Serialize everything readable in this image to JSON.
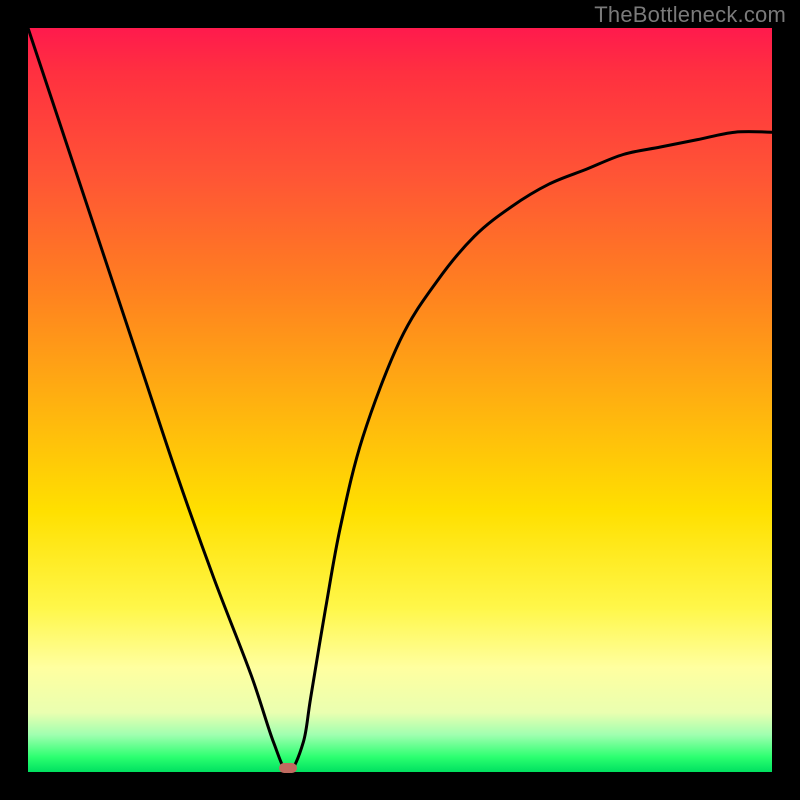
{
  "watermark": "TheBottleneck.com",
  "colors": {
    "frame": "#000000",
    "curve": "#000000",
    "min_marker": "#c06a60",
    "gradient_top": "#ff1a4d",
    "gradient_bottom": "#00e060"
  },
  "chart_data": {
    "type": "line",
    "title": "",
    "xlabel": "",
    "ylabel": "",
    "xlim": [
      0,
      100
    ],
    "ylim": [
      0,
      100
    ],
    "series": [
      {
        "name": "bottleneck-curve",
        "x": [
          0,
          5,
          10,
          15,
          20,
          25,
          30,
          33,
          35,
          37,
          38,
          40,
          42,
          45,
          50,
          55,
          60,
          65,
          70,
          75,
          80,
          85,
          90,
          95,
          100
        ],
        "values": [
          100,
          85,
          70,
          55,
          40,
          26,
          13,
          4,
          0,
          4,
          10,
          22,
          33,
          45,
          58,
          66,
          72,
          76,
          79,
          81,
          83,
          84,
          85,
          86,
          86
        ]
      }
    ],
    "annotations": [
      {
        "name": "min-point",
        "x": 35,
        "y": 0
      }
    ]
  }
}
